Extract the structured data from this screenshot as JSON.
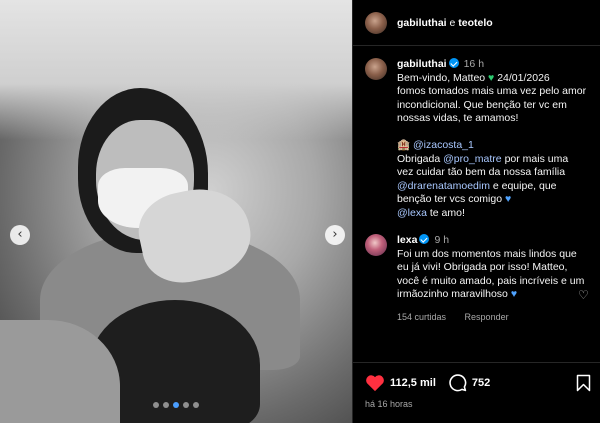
{
  "photo": {
    "description": "",
    "carousel_dots": 5,
    "active_dot": 3
  },
  "header": {
    "user1": "gabiluthai",
    "separator": "e",
    "user2": "teotelo"
  },
  "caption": {
    "username": "gabiluthai",
    "time": "16 h",
    "line1": "Bem-vindo, Matteo",
    "date": "24/01/2026",
    "text1": "fomos tomados mais uma vez pelo amor incondicional. Que benção ter vc em nossas vidas, te amamos!",
    "mention1": "@izacosta_1",
    "text2a": "Obrigada",
    "mention2": "@pro_matre",
    "text2b": "por mais uma vez cuidar tão bem da nossa família",
    "mention3": "@drarenatamoedim",
    "text2c": "e equipe, que benção ter vcs comigo",
    "mention4": "@lexa",
    "text3": "te amo!"
  },
  "reply": {
    "username": "lexa",
    "time": "9 h",
    "text": "Foi um dos momentos mais lindos que eu já vivi! Obrigada por isso! Matteo, você é muito amado, pais incríveis e um irmãozinho maravilhoso",
    "likes_label": "154 curtidas",
    "reply_label": "Responder"
  },
  "actions": {
    "likes": "112,5 mil",
    "comments": "752",
    "timestamp": "há 16 horas"
  },
  "colors": {
    "accent_blue": "#0095f6",
    "like_red": "#ff3040",
    "mention": "#a9c8ff"
  }
}
